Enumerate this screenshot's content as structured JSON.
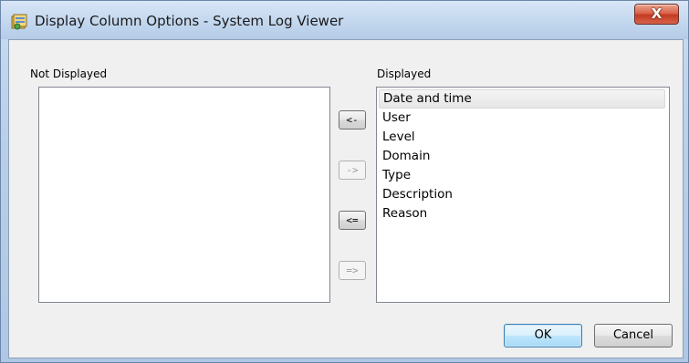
{
  "window": {
    "title": "Display Column Options - System Log Viewer",
    "close_glyph": "X",
    "icon": "app-settings-icon"
  },
  "not_displayed": {
    "label": "Not Displayed",
    "items": []
  },
  "displayed": {
    "label": "Displayed",
    "items": [
      "Date and time",
      "User",
      "Level",
      "Domain",
      "Type",
      "Description",
      "Reason"
    ],
    "selected_index": 0
  },
  "move_buttons": {
    "move_left": "<-",
    "move_right": "->",
    "move_all_left": "<=",
    "move_all_right": "=>"
  },
  "footer": {
    "ok_label": "OK",
    "cancel_label": "Cancel"
  },
  "colors": {
    "titlebar": "#c3d7ee",
    "close_button": "#c33a22",
    "dialog_background": "#f0f0f0",
    "default_button_border": "#3c7fb1"
  }
}
